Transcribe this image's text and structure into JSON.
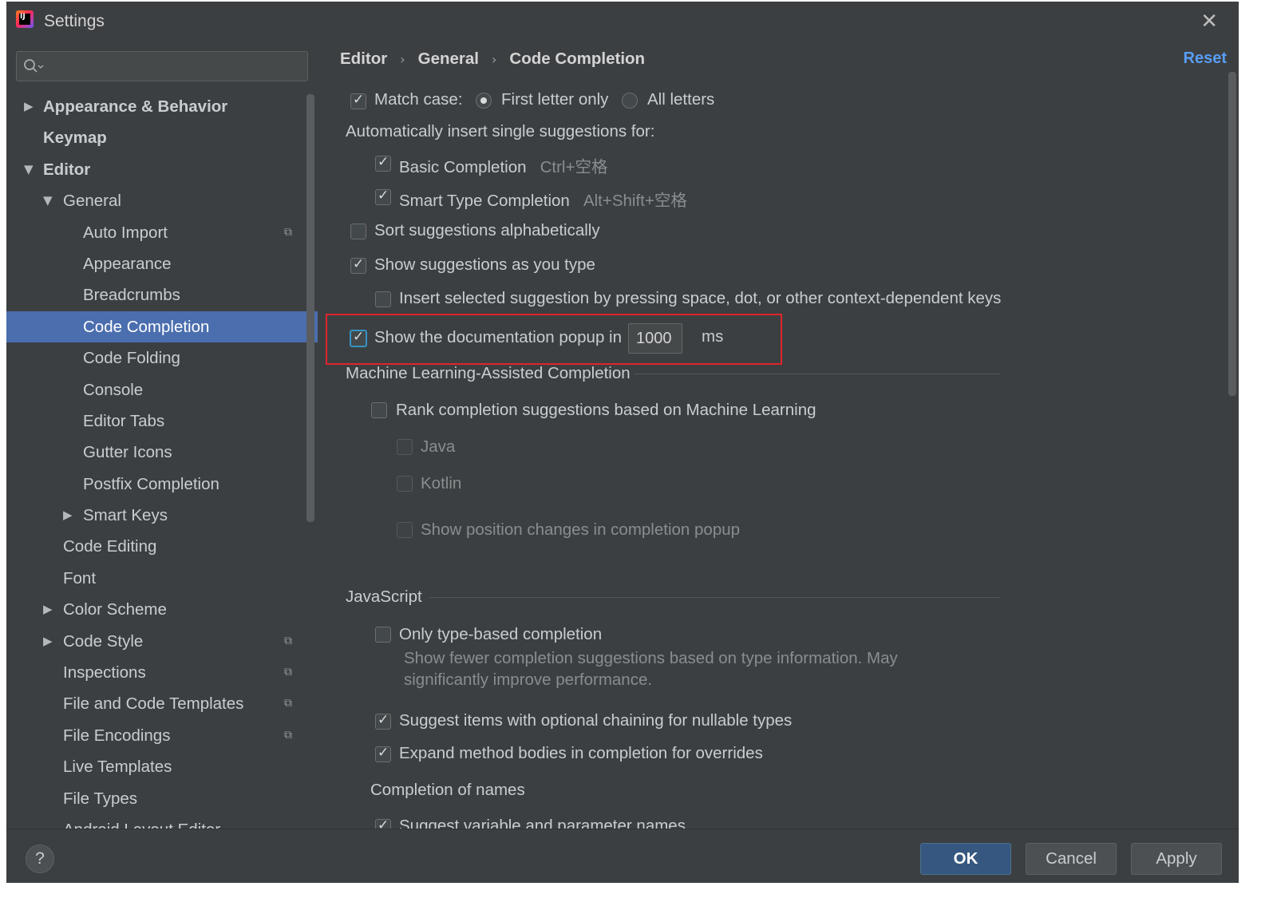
{
  "window": {
    "title": "Settings",
    "close_icon": "close-icon"
  },
  "sidebar": {
    "search": {
      "placeholder": ""
    },
    "items": [
      {
        "label": "Appearance & Behavior",
        "arrow": "▶",
        "bold": true
      },
      {
        "label": "Keymap",
        "bold": true
      },
      {
        "label": "Editor",
        "arrow": "▼",
        "bold": true
      },
      {
        "label": "General",
        "arrow": "▼"
      },
      {
        "label": "Auto Import",
        "icon": "project-settings-icon"
      },
      {
        "label": "Appearance"
      },
      {
        "label": "Breadcrumbs"
      },
      {
        "label": "Code Completion",
        "selected": true
      },
      {
        "label": "Code Folding"
      },
      {
        "label": "Console"
      },
      {
        "label": "Editor Tabs"
      },
      {
        "label": "Gutter Icons"
      },
      {
        "label": "Postfix Completion"
      },
      {
        "label": "Smart Keys",
        "arrow": "▶"
      },
      {
        "label": "Code Editing"
      },
      {
        "label": "Font"
      },
      {
        "label": "Color Scheme",
        "arrow": "▶"
      },
      {
        "label": "Code Style",
        "arrow": "▶",
        "icon": "project-settings-icon"
      },
      {
        "label": "Inspections",
        "icon": "project-settings-icon"
      },
      {
        "label": "File and Code Templates",
        "icon": "project-settings-icon"
      },
      {
        "label": "File Encodings",
        "icon": "project-settings-icon"
      },
      {
        "label": "Live Templates"
      },
      {
        "label": "File Types"
      },
      {
        "label": "Android Layout Editor"
      }
    ]
  },
  "content": {
    "breadcrumb": [
      "Editor",
      "General",
      "Code Completion"
    ],
    "reset_label": "Reset",
    "match_case_label": "Match case:",
    "match_case_checked": true,
    "radio_first_letter": "First letter only",
    "radio_all_letters": "All letters",
    "auto_insert_heading": "Automatically insert single suggestions for:",
    "basic_completion": "Basic Completion",
    "basic_completion_shortcut": "Ctrl+空格",
    "smart_type_completion": "Smart Type Completion",
    "smart_type_shortcut": "Alt+Shift+空格",
    "sort_alpha": "Sort suggestions alphabetically",
    "show_as_type": "Show suggestions as you type",
    "insert_selected": "Insert selected suggestion by pressing space, dot, or other context-dependent keys",
    "doc_popup_label": "Show the documentation popup in",
    "doc_popup_value": "1000",
    "doc_popup_unit": "ms",
    "ml_section": "Machine Learning-Assisted Completion",
    "ml_rank": "Rank completion suggestions based on Machine Learning",
    "ml_java": "Java",
    "ml_kotlin": "Kotlin",
    "ml_show_position": "Show position changes in completion popup",
    "js_section": "JavaScript",
    "js_only_type": "Only type-based completion",
    "js_only_type_desc1": "Show fewer completion suggestions based on type information. May",
    "js_only_type_desc2": "significantly improve performance.",
    "js_optional_chaining": "Suggest items with optional chaining for nullable types",
    "js_expand_method": "Expand method bodies in completion for overrides",
    "completion_of_names": "Completion of names",
    "suggest_variable_names": "Suggest variable and parameter names"
  },
  "footer": {
    "help_label": "?",
    "ok_label": "OK",
    "cancel_label": "Cancel",
    "apply_label": "Apply"
  },
  "colors": {
    "background": "#3c3f41",
    "selection": "#4b6eaf",
    "link": "#589df6",
    "primary_button": "#365880",
    "highlight_border": "#e0242c"
  }
}
